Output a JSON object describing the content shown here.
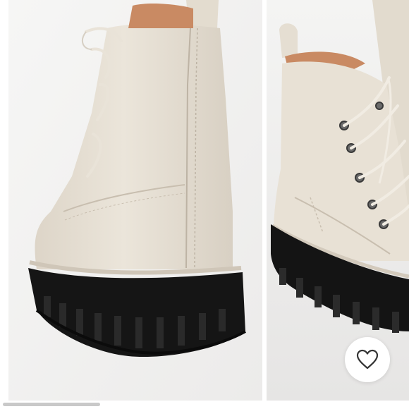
{
  "listing": {
    "images": [
      {
        "icon": "boot-back-view-photo"
      },
      {
        "icon": "boot-side-view-photo"
      }
    ],
    "favorite": {
      "icon": "heart-outline-icon",
      "selected": false
    },
    "carousel": {
      "image_count": 2,
      "scroll_fraction": 0.24
    }
  },
  "colors": {
    "background": "#ffffff",
    "photo_bg": "#f1f1f0",
    "leather": "#e7e0d4",
    "sole": "#141414",
    "heart_outline": "#333333"
  }
}
